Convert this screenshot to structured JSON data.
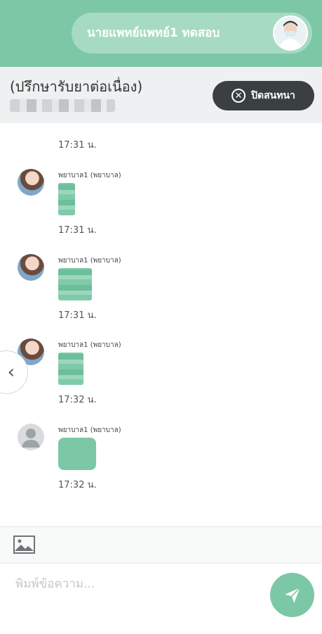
{
  "header": {
    "doctor_name": "นายแพทย์แพทย์1 ทดสอบ",
    "consult_title": "(ปรึกษารับยาต่อเนื่อง)",
    "close_chat_label": "ปิดสนทนา",
    "close_icon": "x-circle-icon",
    "accent_color": "#7cc7a6"
  },
  "chat": {
    "cut_time": "17:31 น.",
    "messages": [
      {
        "sender": "พยาบาล1 (พยาบาล)",
        "time": "17:31 น.",
        "avatar": "nurse-photo"
      },
      {
        "sender": "พยาบาล1 (พยาบาล)",
        "time": "17:31 น.",
        "avatar": "nurse-photo"
      },
      {
        "sender": "พยาบาล1 (พยาบาล)",
        "time": "17:32 น.",
        "avatar": "nurse-photo"
      },
      {
        "sender": "พยาบาล1 (พยาบาล)",
        "time": "17:32 น.",
        "avatar": "default-user-icon"
      }
    ]
  },
  "composer": {
    "placeholder": "พิมพ์ข้อความ...",
    "image_icon": "image-icon",
    "send_icon": "send-icon",
    "side_toggle_icon": "chevron-left-icon"
  }
}
